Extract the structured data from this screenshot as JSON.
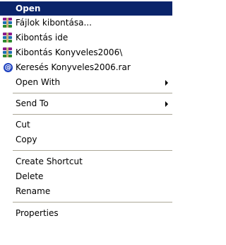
{
  "menu": {
    "items": [
      {
        "label": "Open"
      },
      {
        "label": "Fájlok kibontása..."
      },
      {
        "label": "Kibontás ide"
      },
      {
        "label": "Kibontás Konyveles2006\\"
      },
      {
        "label": "Keresés Konyveles2006.rar"
      },
      {
        "label": "Open With"
      },
      {
        "label": "Send To"
      },
      {
        "label": "Cut"
      },
      {
        "label": "Copy"
      },
      {
        "label": "Create Shortcut"
      },
      {
        "label": "Delete"
      },
      {
        "label": "Rename"
      },
      {
        "label": "Properties"
      }
    ],
    "icons": {
      "rar": "winrar-archive-icon",
      "search": "search-app-icon",
      "search_glyph": "@"
    },
    "colors": {
      "selected_bg": "#0a246a",
      "selected_fg": "#ffffff",
      "separator": "#aca899"
    }
  }
}
